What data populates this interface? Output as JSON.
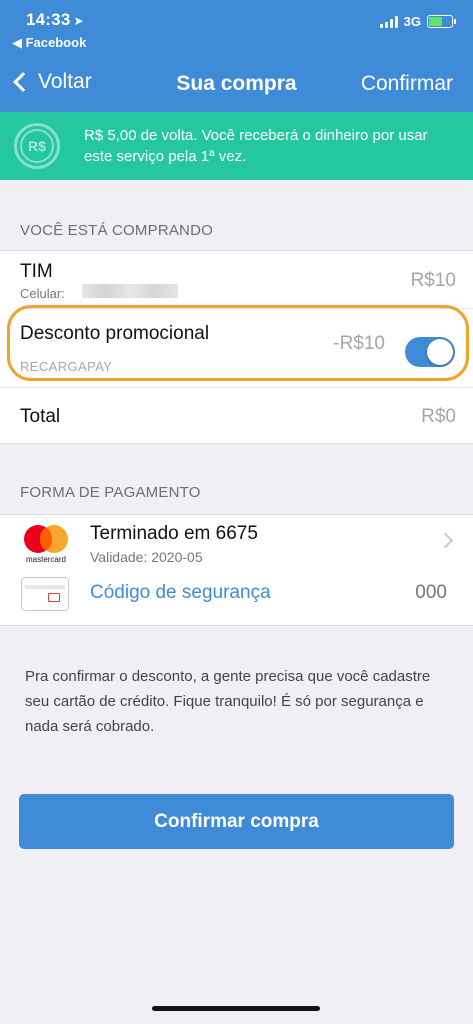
{
  "status_bar": {
    "time": "14:33",
    "back_app": "◀ Facebook",
    "network": "3G"
  },
  "nav": {
    "back_label": "Voltar",
    "title": "Sua compra",
    "confirm_label": "Confirmar"
  },
  "banner": {
    "icon_text": "R$",
    "text": "R$ 5,00 de volta. Você receberá o dinheiro por usar este serviço pela 1ª vez."
  },
  "purchase": {
    "header": "VOCÊ ESTÁ COMPRANDO",
    "product_name": "TIM",
    "product_sub": "Celular:",
    "product_price": "R$10",
    "discount_title": "Desconto promocional",
    "discount_sub": "RECARGAPAY",
    "discount_value": "-R$10",
    "discount_enabled": true,
    "total_label": "Total",
    "total_value": "R$0"
  },
  "payment": {
    "header": "FORMA DE PAGAMENTO",
    "card_brand": "mastercard",
    "card_title": "Terminado em 6675",
    "card_validity": "Validade: 2020-05",
    "security_label": "Código de segurança",
    "security_placeholder": "000"
  },
  "info": {
    "text": "Pra confirmar o desconto, a gente precisa que você cadastre seu cartão de crédito. Fique tranquilo! É só por segurança e nada será cobrado."
  },
  "confirm_button": "Confirmar compra",
  "colors": {
    "primary": "#3f8bd8",
    "banner": "#24c7a0",
    "highlight": "#f0a229"
  }
}
